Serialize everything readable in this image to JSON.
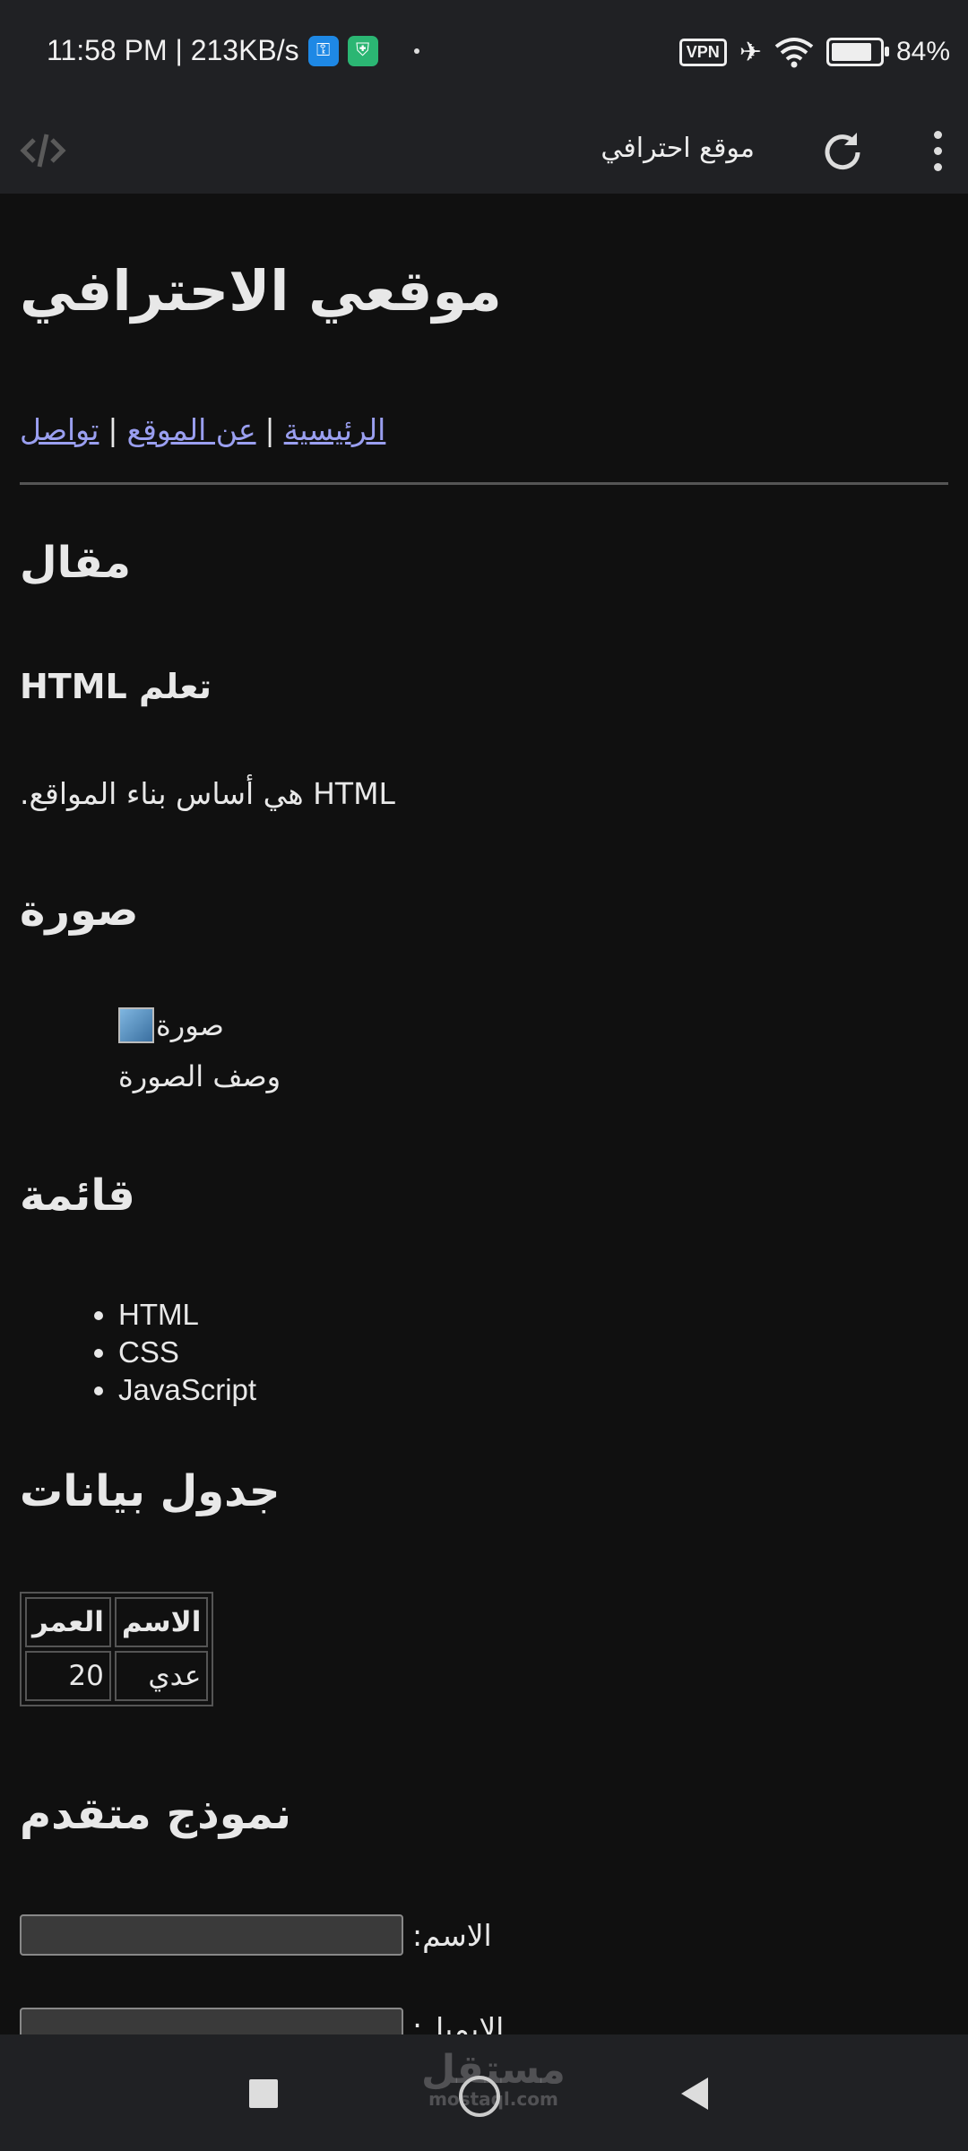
{
  "status_bar": {
    "time_speed": "11:58 PM | 213KB/s",
    "vpn": "VPN",
    "battery": "84%",
    "battery_level": 0.84
  },
  "toolbar": {
    "title": "موقع احترافي"
  },
  "page": {
    "heading": "موقعي الاحترافي",
    "nav": [
      "الرئيسية",
      "عن الموقع",
      "تواصل"
    ],
    "nav_sep": "|",
    "article": {
      "section_title": "مقال",
      "title": "تعلم HTML",
      "text": "HTML هي أساس بناء المواقع."
    },
    "image_section": {
      "title": "صورة",
      "alt": "صورة",
      "caption": "وصف الصورة"
    },
    "list_section": {
      "title": "قائمة",
      "items": [
        "HTML",
        "CSS",
        "JavaScript"
      ]
    },
    "table_section": {
      "title": "جدول بيانات",
      "headers": [
        "الاسم",
        "العمر"
      ],
      "rows": [
        [
          "عدي",
          "20"
        ]
      ]
    },
    "form_section": {
      "title": "نموذج متقدم",
      "name_label": "الاسم:",
      "email_label": "الايميل:"
    }
  },
  "watermark": {
    "text": "مستقل",
    "sub": "mostaql.com"
  }
}
